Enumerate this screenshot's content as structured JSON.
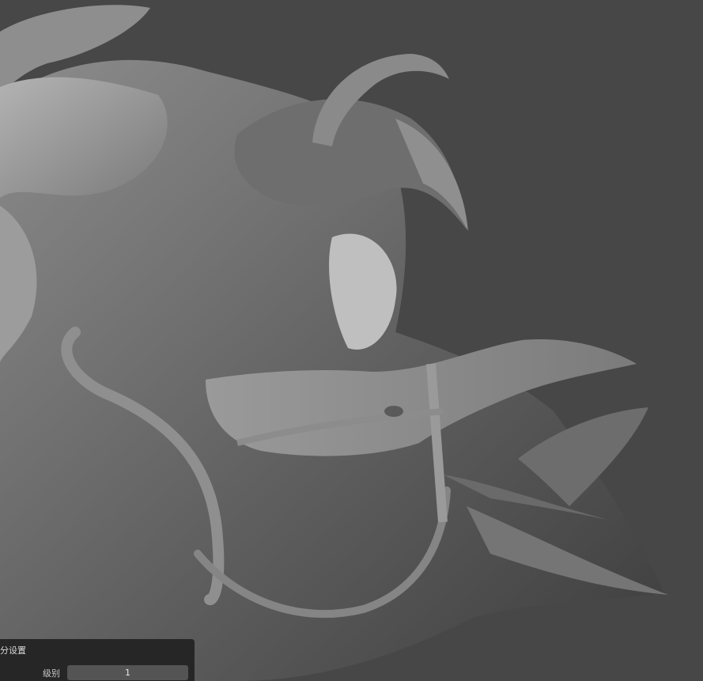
{
  "viewport": {
    "background": "#474747",
    "model_color": "#7a7a7a"
  },
  "panel": {
    "title": "分设置",
    "fields": [
      {
        "label": "级别",
        "value": "1"
      }
    ]
  }
}
